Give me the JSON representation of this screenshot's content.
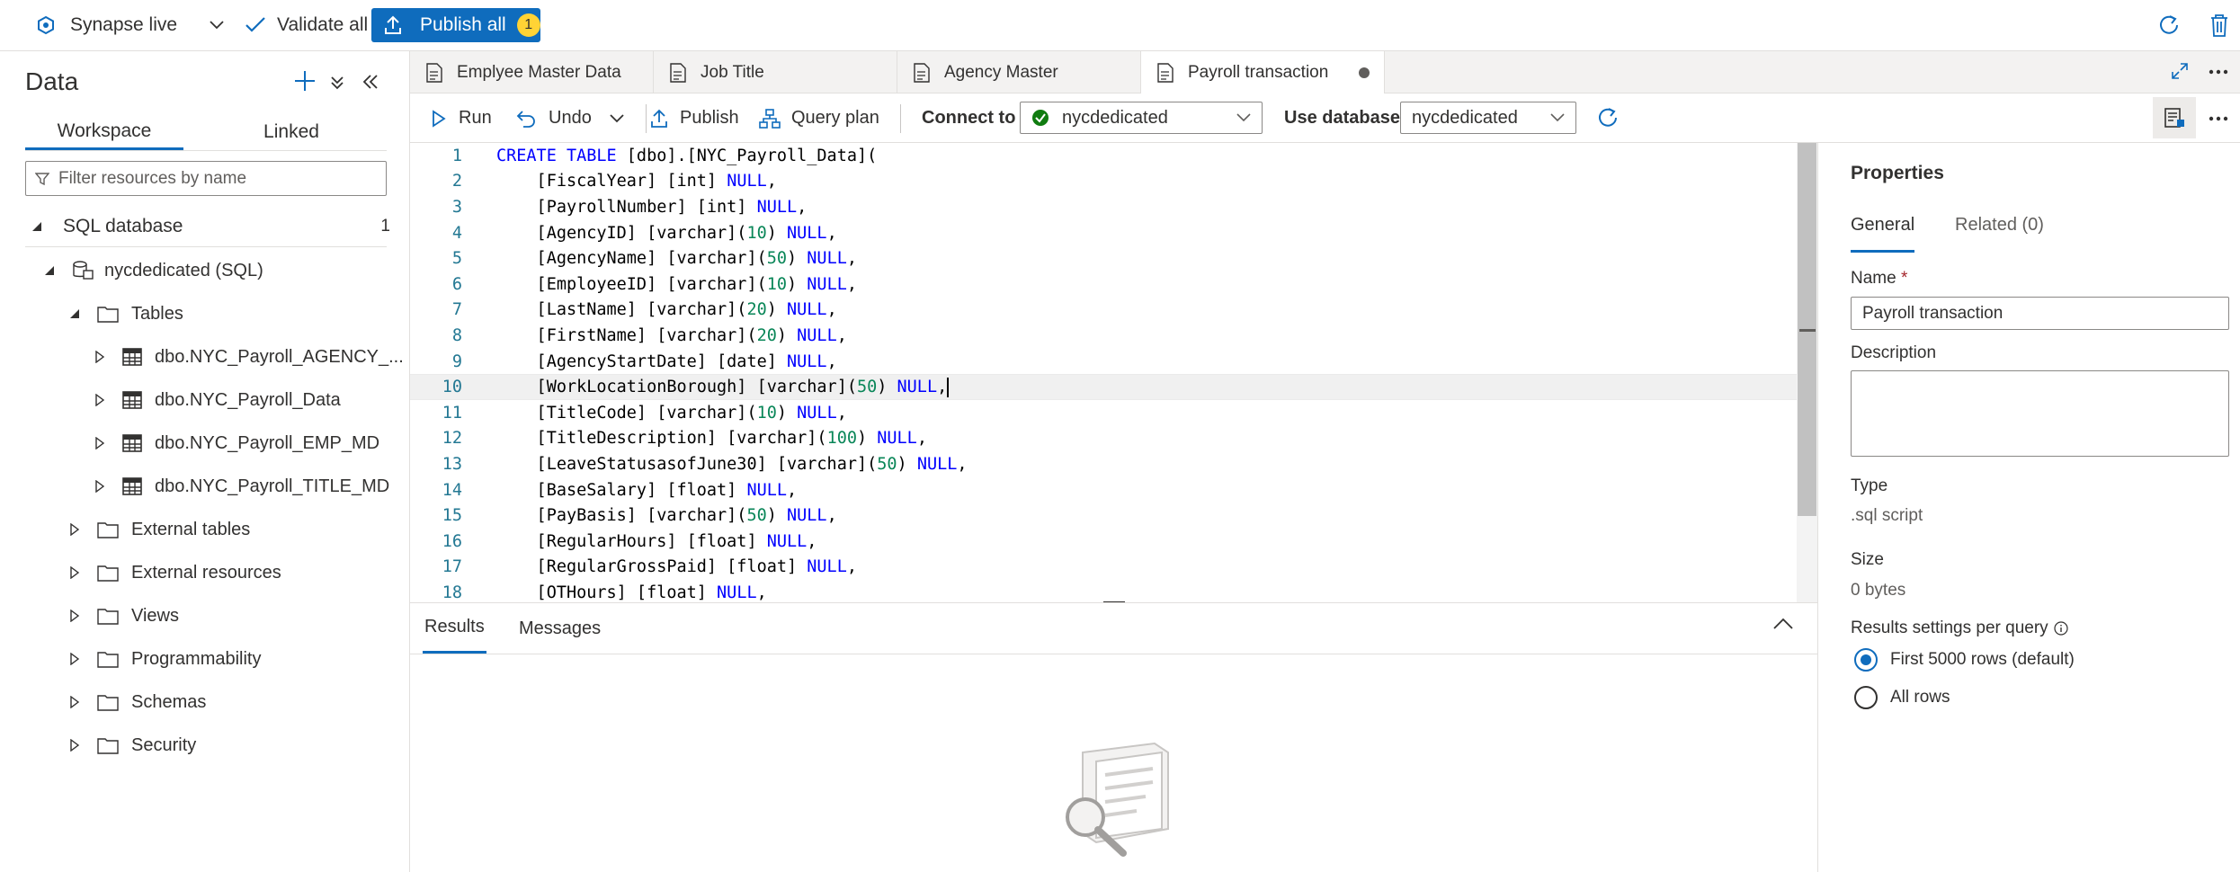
{
  "topbar": {
    "mode_label": "Synapse live",
    "validate_label": "Validate all",
    "publish_label": "Publish all",
    "publish_count": "1"
  },
  "left_panel": {
    "title": "Data",
    "tabs": [
      "Workspace",
      "Linked"
    ],
    "filter_placeholder": "Filter resources by name",
    "section_label": "SQL database",
    "section_count": "1",
    "database_label": "nycdedicated (SQL)",
    "tables_label": "Tables",
    "tables": [
      "dbo.NYC_Payroll_AGENCY_...",
      "dbo.NYC_Payroll_Data",
      "dbo.NYC_Payroll_EMP_MD",
      "dbo.NYC_Payroll_TITLE_MD"
    ],
    "folders": [
      "External tables",
      "External resources",
      "Views",
      "Programmability",
      "Schemas",
      "Security"
    ]
  },
  "doc_tabs": [
    "Emplyee Master Data",
    "Job Title",
    "Agency Master",
    "Payroll transaction"
  ],
  "toolbar": {
    "run_label": "Run",
    "undo_label": "Undo",
    "publish_label": "Publish",
    "query_plan_label": "Query plan",
    "connect_label": "Connect to",
    "connect_value": "nycdedicated",
    "use_db_label": "Use database",
    "use_db_value": "nycdedicated"
  },
  "editor": {
    "current_line": 10,
    "lines": [
      {
        "n": "1",
        "parts": [
          [
            "kw",
            "CREATE TABLE"
          ],
          [
            "",
            " [dbo].[NYC_Payroll_Data]("
          ]
        ]
      },
      {
        "n": "2",
        "parts": [
          [
            "",
            "    [FiscalYear] [int] "
          ],
          [
            "nul",
            "NULL"
          ],
          [
            "",
            ","
          ]
        ]
      },
      {
        "n": "3",
        "parts": [
          [
            "",
            "    [PayrollNumber] [int] "
          ],
          [
            "nul",
            "NULL"
          ],
          [
            "",
            ","
          ]
        ]
      },
      {
        "n": "4",
        "parts": [
          [
            "",
            "    [AgencyID] [varchar]("
          ],
          [
            "num",
            "10"
          ],
          [
            "",
            ") "
          ],
          [
            "nul",
            "NULL"
          ],
          [
            "",
            ","
          ]
        ]
      },
      {
        "n": "5",
        "parts": [
          [
            "",
            "    [AgencyName] [varchar]("
          ],
          [
            "num",
            "50"
          ],
          [
            "",
            ") "
          ],
          [
            "nul",
            "NULL"
          ],
          [
            "",
            ","
          ]
        ]
      },
      {
        "n": "6",
        "parts": [
          [
            "",
            "    [EmployeeID] [varchar]("
          ],
          [
            "num",
            "10"
          ],
          [
            "",
            ") "
          ],
          [
            "nul",
            "NULL"
          ],
          [
            "",
            ","
          ]
        ]
      },
      {
        "n": "7",
        "parts": [
          [
            "",
            "    [LastName] [varchar]("
          ],
          [
            "num",
            "20"
          ],
          [
            "",
            ") "
          ],
          [
            "nul",
            "NULL"
          ],
          [
            "",
            ","
          ]
        ]
      },
      {
        "n": "8",
        "parts": [
          [
            "",
            "    [FirstName] [varchar]("
          ],
          [
            "num",
            "20"
          ],
          [
            "",
            ") "
          ],
          [
            "nul",
            "NULL"
          ],
          [
            "",
            ","
          ]
        ]
      },
      {
        "n": "9",
        "parts": [
          [
            "",
            "    [AgencyStartDate] [date] "
          ],
          [
            "nul",
            "NULL"
          ],
          [
            "",
            ","
          ]
        ]
      },
      {
        "n": "10",
        "parts": [
          [
            "",
            "    [WorkLocationBorough] [varchar]("
          ],
          [
            "num",
            "50"
          ],
          [
            "",
            ") "
          ],
          [
            "nul",
            "NULL"
          ],
          [
            "",
            ","
          ]
        ]
      },
      {
        "n": "11",
        "parts": [
          [
            "",
            "    [TitleCode] [varchar]("
          ],
          [
            "num",
            "10"
          ],
          [
            "",
            ") "
          ],
          [
            "nul",
            "NULL"
          ],
          [
            "",
            ","
          ]
        ]
      },
      {
        "n": "12",
        "parts": [
          [
            "",
            "    [TitleDescription] [varchar]("
          ],
          [
            "num",
            "100"
          ],
          [
            "",
            ") "
          ],
          [
            "nul",
            "NULL"
          ],
          [
            "",
            ","
          ]
        ]
      },
      {
        "n": "13",
        "parts": [
          [
            "",
            "    [LeaveStatusasofJune30] [varchar]("
          ],
          [
            "num",
            "50"
          ],
          [
            "",
            ") "
          ],
          [
            "nul",
            "NULL"
          ],
          [
            "",
            ","
          ]
        ]
      },
      {
        "n": "14",
        "parts": [
          [
            "",
            "    [BaseSalary] [float] "
          ],
          [
            "nul",
            "NULL"
          ],
          [
            "",
            ","
          ]
        ]
      },
      {
        "n": "15",
        "parts": [
          [
            "",
            "    [PayBasis] [varchar]("
          ],
          [
            "num",
            "50"
          ],
          [
            "",
            ") "
          ],
          [
            "nul",
            "NULL"
          ],
          [
            "",
            ","
          ]
        ]
      },
      {
        "n": "16",
        "parts": [
          [
            "",
            "    [RegularHours] [float] "
          ],
          [
            "nul",
            "NULL"
          ],
          [
            "",
            ","
          ]
        ]
      },
      {
        "n": "17",
        "parts": [
          [
            "",
            "    [RegularGrossPaid] [float] "
          ],
          [
            "nul",
            "NULL"
          ],
          [
            "",
            ","
          ]
        ]
      },
      {
        "n": "18",
        "parts": [
          [
            "",
            "    [OTHours] [float] "
          ],
          [
            "nul",
            "NULL"
          ],
          [
            "",
            ","
          ]
        ]
      }
    ]
  },
  "results": {
    "tabs": [
      "Results",
      "Messages"
    ]
  },
  "properties": {
    "title": "Properties",
    "tabs": [
      "General",
      "Related (0)"
    ],
    "name_label": "Name",
    "required_mark": "*",
    "name_value": "Payroll transaction",
    "description_label": "Description",
    "type_label": "Type",
    "type_value": ".sql script",
    "size_label": "Size",
    "size_value": "0 bytes",
    "results_settings_label": "Results settings per query",
    "options": [
      "First 5000 rows (default)",
      "All rows"
    ]
  },
  "colors": {
    "accent": "#0f6cbd",
    "keyword": "#0000ff",
    "number": "#098658",
    "line_number": "#237893",
    "success": "#107c10"
  }
}
